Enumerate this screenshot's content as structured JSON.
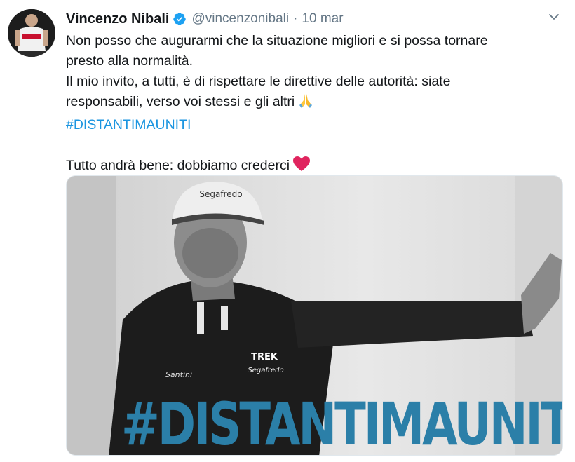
{
  "tweet": {
    "display_name": "Vincenzo Nibali",
    "handle": "@vincenzonibali",
    "separator": "·",
    "date": "10 mar",
    "verified_icon": "verified-badge-icon",
    "menu_icon": "chevron-down-icon",
    "lines": [
      "Non posso che augurarmi che la situazione migliori e si possa tornare",
      "presto alla normalità.",
      "Il mio invito, a tutti, è di rispettare le direttive delle autorità: siate",
      "responsabili, verso voi stessi e gli altri"
    ],
    "hashtag": "#DISTANTIMAUNITI",
    "closing": "Tutto andrà bene: dobbiamo crederci",
    "emojis": [
      "folded-hands-emoji",
      "red-heart-emoji"
    ],
    "media_caption": "#DISTANTIMAUNITI",
    "cap_text": "Segafredo",
    "jersey_brand": "TREK",
    "jersey_sponsor": "Segafredo",
    "jersey_maker": "Santini"
  },
  "colors": {
    "text": "#14171a",
    "muted": "#657786",
    "link": "#1b95e0",
    "verified": "#1da1f2",
    "media_caption": "#2b7fa8",
    "heart": "#e0245e"
  }
}
